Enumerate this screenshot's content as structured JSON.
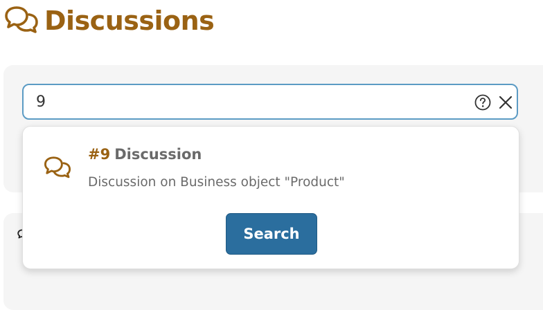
{
  "header": {
    "title": "Discussions",
    "icon": "discussion-icon"
  },
  "search": {
    "value": "9",
    "help_icon": "help-icon",
    "clear_icon": "close-icon"
  },
  "results": [
    {
      "number": "#9",
      "type": "Discussion",
      "description": "Discussion on Business object \"Product\"",
      "icon": "discussion-icon"
    }
  ],
  "search_button": {
    "label": "Search"
  },
  "colors": {
    "brand": "#9a6213",
    "accent": "#2b6e9e",
    "focus_border": "#5b9bc4"
  }
}
